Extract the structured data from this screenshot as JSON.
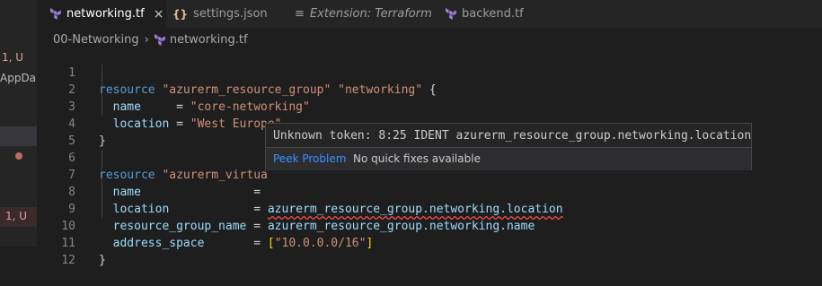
{
  "sidebar": {
    "badge_top": "1, U",
    "text_appdata": "AppDa...",
    "badge_bottom": "1, U"
  },
  "tabs": [
    {
      "label": "networking.tf",
      "close": "×",
      "icon": "terraform-icon"
    },
    {
      "label": "settings.json",
      "icon": "json-braces-icon",
      "glyph": "{}"
    },
    {
      "label": "Extension: Terraform",
      "icon": "extension-icon",
      "glyph": "≡"
    },
    {
      "label": "backend.tf",
      "icon": "terraform-icon"
    }
  ],
  "breadcrumb": {
    "folder": "00-Networking",
    "separator": "›",
    "file": "networking.tf"
  },
  "code": {
    "lines": [
      {
        "n": "1"
      },
      {
        "n": "2"
      },
      {
        "n": "3"
      },
      {
        "n": "4"
      },
      {
        "n": "5"
      },
      {
        "n": "6"
      },
      {
        "n": "7"
      },
      {
        "n": "8"
      },
      {
        "n": "9"
      },
      {
        "n": "10"
      },
      {
        "n": "11"
      },
      {
        "n": "12"
      }
    ],
    "l1": {
      "kw": "resource",
      "type": "\"azurerm_resource_group\"",
      "name": "\"networking\"",
      "brace": "{"
    },
    "l2": {
      "attr": "name",
      "eq": "=",
      "val": "\"core-networking\""
    },
    "l3": {
      "attr": "location",
      "eq": "=",
      "val": "\"West Europe\""
    },
    "l4": {
      "brace": "}"
    },
    "l6": {
      "kw": "resource",
      "type": "\"azurerm_virtua"
    },
    "l7": {
      "attr": "name",
      "eq": "="
    },
    "l8": {
      "attr": "location",
      "eq": "=",
      "val": "azurerm_resource_group.networking.location"
    },
    "l9": {
      "attr": "resource_group_name",
      "eq": "=",
      "val": "azurerm_resource_group.networking.name"
    },
    "l10": {
      "attr": "address_space",
      "eq": "=",
      "open": "[",
      "val": "\"10.0.0.0/16\"",
      "close": "]"
    },
    "l12": {
      "brace": "}"
    }
  },
  "hover": {
    "message": "Unknown token: 8:25 IDENT azurerm_resource_group.networking.location",
    "peek": "Peek Problem",
    "nofix": "No quick fixes available"
  }
}
